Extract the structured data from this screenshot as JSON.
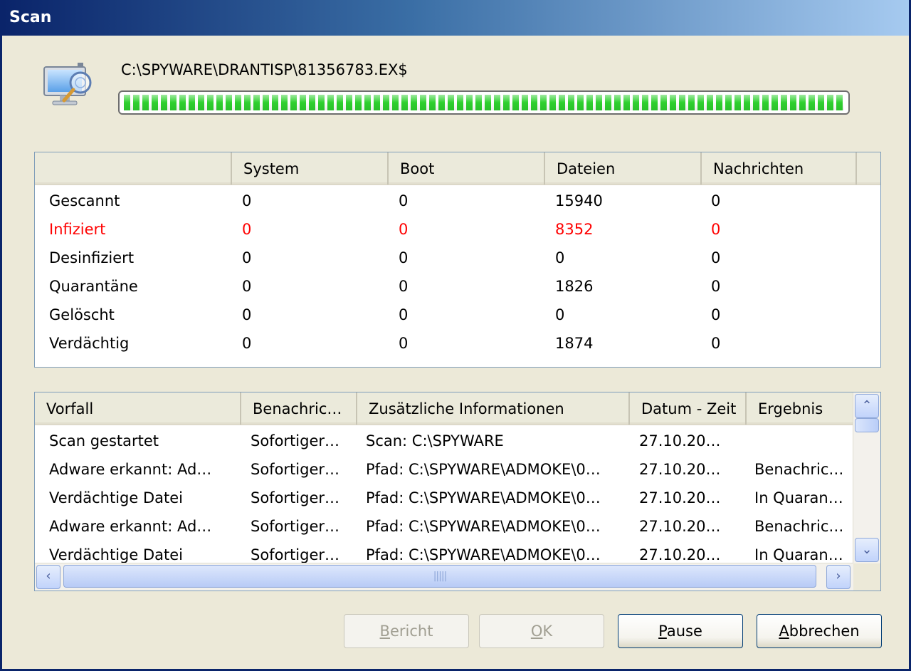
{
  "window": {
    "title": "Scan"
  },
  "scan": {
    "current_path": "C:\\SPYWARE\\DRANTISP\\81356783.EX$",
    "progress_fraction": 1.0
  },
  "stats": {
    "headers": [
      "",
      "System",
      "Boot",
      "Dateien",
      "Nachrichten"
    ],
    "rows": [
      {
        "label": "Gescannt",
        "system": "0",
        "boot": "0",
        "dateien": "15940",
        "nachrichten": "0"
      },
      {
        "label": "Infiziert",
        "system": "0",
        "boot": "0",
        "dateien": "8352",
        "nachrichten": "0"
      },
      {
        "label": "Desinfiziert",
        "system": "0",
        "boot": "0",
        "dateien": "0",
        "nachrichten": "0"
      },
      {
        "label": "Quarantäne",
        "system": "0",
        "boot": "0",
        "dateien": "1826",
        "nachrichten": "0"
      },
      {
        "label": "Gelöscht",
        "system": "0",
        "boot": "0",
        "dateien": "0",
        "nachrichten": "0"
      },
      {
        "label": "Verdächtig",
        "system": "0",
        "boot": "0",
        "dateien": "1874",
        "nachrichten": "0"
      }
    ]
  },
  "events": {
    "headers": [
      "Vorfall",
      "Benachric…",
      "Zusätzliche Informationen",
      "Datum - Zeit",
      "Ergebnis"
    ],
    "rows": [
      {
        "vorfall": "Scan gestartet",
        "benachrichtigung": "Sofortiger…",
        "info": "Scan: C:\\SPYWARE",
        "datum": "27.10.20…",
        "ergebnis": ""
      },
      {
        "vorfall": "Adware erkannt: Ad…",
        "benachrichtigung": "Sofortiger…",
        "info": "Pfad: C:\\SPYWARE\\ADMOKE\\0…",
        "datum": "27.10.20…",
        "ergebnis": "Benachric…"
      },
      {
        "vorfall": "Verdächtige Datei",
        "benachrichtigung": "Sofortiger…",
        "info": "Pfad: C:\\SPYWARE\\ADMOKE\\0…",
        "datum": "27.10.20…",
        "ergebnis": "In Quaran…"
      },
      {
        "vorfall": "Adware erkannt: Ad…",
        "benachrichtigung": "Sofortiger…",
        "info": "Pfad: C:\\SPYWARE\\ADMOKE\\0…",
        "datum": "27.10.20…",
        "ergebnis": "Benachric…"
      },
      {
        "vorfall": "Verdächtige Datei",
        "benachrichtigung": "Sofortiger…",
        "info": "Pfad: C:\\SPYWARE\\ADMOKE\\0…",
        "datum": "27.10.20…",
        "ergebnis": "In Quaran…"
      }
    ]
  },
  "buttons": {
    "report": {
      "label": "Bericht",
      "enabled": false
    },
    "ok": {
      "label": "OK",
      "enabled": false
    },
    "pause": {
      "label": "Pause",
      "enabled": true
    },
    "cancel": {
      "label": "Abbrechen",
      "enabled": true
    }
  },
  "colors": {
    "infected": "#ff0000",
    "progress": "#2fd02f",
    "title_start": "#0a246a",
    "title_end": "#a6caf0"
  },
  "icons": {
    "scan": "monitor-magnifier-icon",
    "scroll_up": "chevron-up-icon",
    "scroll_down": "chevron-down-icon",
    "scroll_left": "chevron-left-icon",
    "scroll_right": "chevron-right-icon"
  }
}
